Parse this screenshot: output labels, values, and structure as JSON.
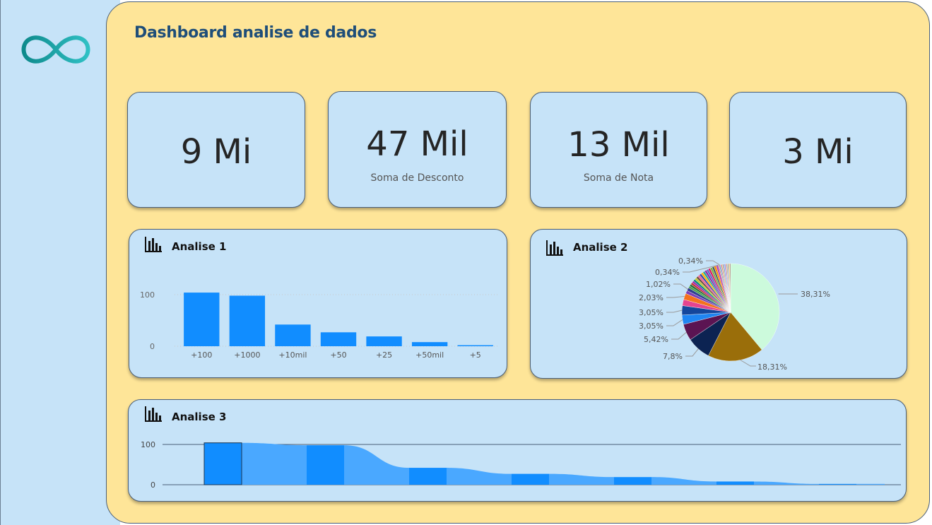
{
  "header": {
    "title": "Dashboard analise de dados"
  },
  "logo": {
    "icon": "infinity-icon",
    "color_dark": "#0e8a8c",
    "color_light": "#2fc0c4"
  },
  "kpis": [
    {
      "value": "9 Mi",
      "label": ""
    },
    {
      "value": "47 Mil",
      "label": "Soma de Desconto"
    },
    {
      "value": "13 Mil",
      "label": "Soma de Nota"
    },
    {
      "value": "3 Mi",
      "label": ""
    }
  ],
  "colors": {
    "background_panel": "#fee598",
    "card": "#c6e3f8",
    "title": "#1f4e79",
    "bar": "#118dff",
    "bar_light": "#4aa8ff"
  },
  "chart_data": [
    {
      "type": "bar",
      "title": "Analise 1",
      "icon": "bar-chart-icon",
      "categories": [
        "+100",
        "+1000",
        "+10mil",
        "+50",
        "+25",
        "+50mil",
        "+5"
      ],
      "values": [
        104,
        98,
        42,
        27,
        19,
        8,
        2
      ],
      "yticks": [
        "100",
        "0"
      ],
      "ylim": [
        0,
        130
      ]
    },
    {
      "type": "pie",
      "title": "Analise 2",
      "icon": "bar-chart-icon",
      "slices": [
        {
          "value": 38.31,
          "label": "38,31%",
          "color": "#ccfadc"
        },
        {
          "value": 18.31,
          "label": "18,31%",
          "color": "#9a6e0a"
        },
        {
          "value": 7.8,
          "label": "7,8%",
          "color": "#0c2352"
        },
        {
          "value": 5.42,
          "label": "5,42%",
          "color": "#5b1452"
        },
        {
          "value": 3.05,
          "label": "3,05%",
          "color": "#1f85f2"
        },
        {
          "value": 3.05,
          "label": "3,05%",
          "color": "#14469c"
        },
        {
          "value": 2.03,
          "label": "",
          "color": "#e4448f"
        },
        {
          "value": 2.03,
          "label": "2,03%",
          "color": "#f5721d"
        },
        {
          "value": 1.02,
          "label": "",
          "color": "#7a3fb8"
        },
        {
          "value": 1.02,
          "label": "1,02%",
          "color": "#2e3f8f"
        },
        {
          "value": 0.68,
          "label": "",
          "color": "#43a047"
        },
        {
          "value": 0.68,
          "label": "",
          "color": "#1e6b34"
        },
        {
          "value": 0.68,
          "label": "",
          "color": "#c43333"
        },
        {
          "value": 0.68,
          "label": "",
          "color": "#9c27b0"
        },
        {
          "value": 0.68,
          "label": "",
          "color": "#00897b"
        },
        {
          "value": 0.68,
          "label": "",
          "color": "#c0ca33"
        },
        {
          "value": 0.68,
          "label": "",
          "color": "#6d4c41"
        },
        {
          "value": 0.68,
          "label": "",
          "color": "#f06292"
        },
        {
          "value": 0.68,
          "label": "",
          "color": "#3949ab"
        },
        {
          "value": 0.68,
          "label": "",
          "color": "#ffb300"
        },
        {
          "value": 0.68,
          "label": "",
          "color": "#26a69a"
        },
        {
          "value": 0.68,
          "label": "",
          "color": "#8e24aa"
        },
        {
          "value": 0.68,
          "label": "",
          "color": "#5c6bc0"
        },
        {
          "value": 0.68,
          "label": "",
          "color": "#d81b60"
        },
        {
          "value": 0.68,
          "label": "",
          "color": "#7cb342"
        },
        {
          "value": 0.68,
          "label": "",
          "color": "#455a64"
        },
        {
          "value": 0.68,
          "label": "",
          "color": "#fb8c00"
        },
        {
          "value": 0.68,
          "label": "",
          "color": "#ab47bc"
        },
        {
          "value": 0.34,
          "label": "0,34%",
          "color": "#e57373"
        },
        {
          "value": 0.34,
          "label": "0,34%",
          "color": "#4db6ac"
        },
        {
          "value": 0.34,
          "label": "",
          "color": "#9575cd"
        },
        {
          "value": 0.34,
          "label": "",
          "color": "#ff8a65"
        },
        {
          "value": 0.34,
          "label": "",
          "color": "#81c784"
        },
        {
          "value": 0.34,
          "label": "",
          "color": "#ba68c8"
        },
        {
          "value": 0.34,
          "label": "",
          "color": "#4fc3f7"
        },
        {
          "value": 0.34,
          "label": "",
          "color": "#f06292"
        },
        {
          "value": 0.34,
          "label": "",
          "color": "#aed581"
        },
        {
          "value": 0.34,
          "label": "",
          "color": "#7986cb"
        },
        {
          "value": 0.34,
          "label": "",
          "color": "#ffd54f"
        },
        {
          "value": 0.34,
          "label": "",
          "color": "#a1887f"
        }
      ]
    },
    {
      "type": "bar",
      "title": "Analise 3",
      "icon": "bar-chart-icon",
      "values": [
        104,
        98,
        42,
        27,
        19,
        8,
        2
      ],
      "yticks": [
        "100",
        "0"
      ],
      "ylim": [
        0,
        105
      ]
    }
  ]
}
